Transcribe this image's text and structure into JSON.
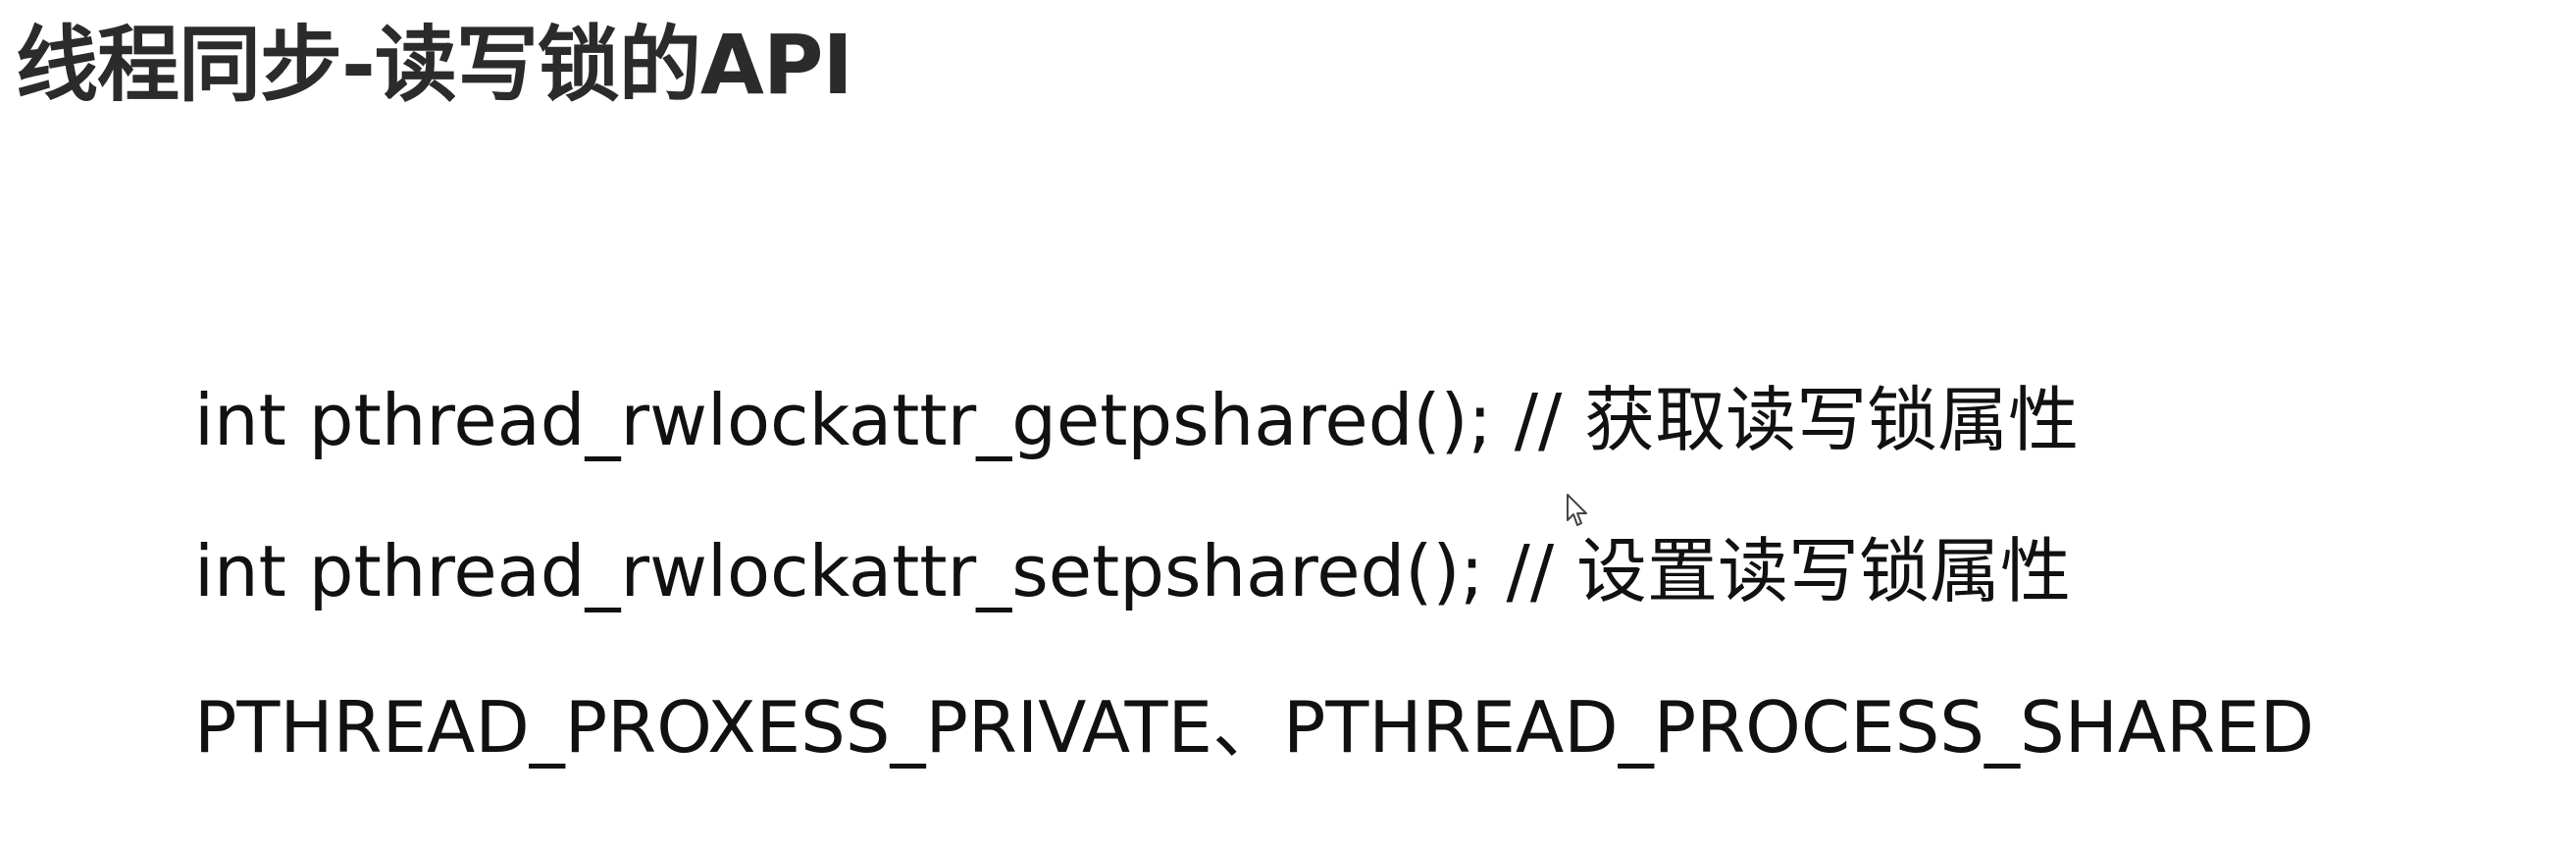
{
  "slide": {
    "title": "线程同步-读写锁的API",
    "lines": [
      {
        "code": "int pthread_rwlockattr_getpshared();",
        "comment": " // 获取读写锁属性"
      },
      {
        "code": "int pthread_rwlockattr_setpshared();",
        "comment": " // 设置读写锁属性"
      },
      {
        "code": "PTHREAD_PROXESS_PRIVATE、PTHREAD_PROCESS_SHARED"
      }
    ]
  },
  "icons": {
    "cursor": "mouse-pointer-icon"
  }
}
